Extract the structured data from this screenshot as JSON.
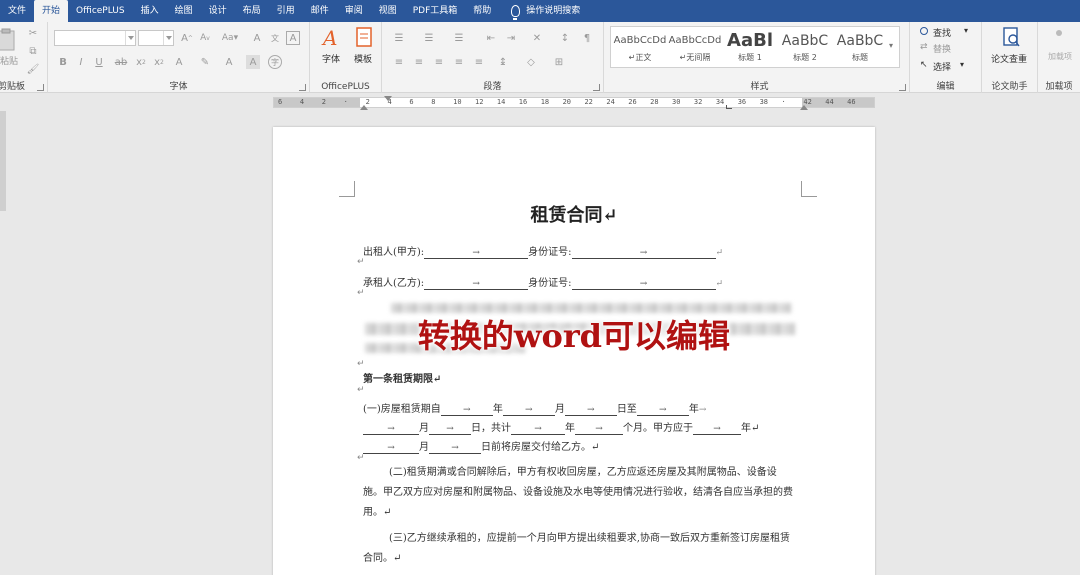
{
  "tabs": [
    "文件",
    "开始",
    "OfficePLUS",
    "插入",
    "绘图",
    "设计",
    "布局",
    "引用",
    "邮件",
    "审阅",
    "视图",
    "PDF工具箱",
    "帮助"
  ],
  "tell_me": "操作说明搜索",
  "ribbon": {
    "clipboard": {
      "paste": "粘贴",
      "label": "剪贴板"
    },
    "font": {
      "label": "字体"
    },
    "officeplus": {
      "font_btn": "字体",
      "template_btn": "模板",
      "label": "OfficePLUS"
    },
    "paragraph": {
      "label": "段落"
    },
    "styles": {
      "label": "样式",
      "items": [
        {
          "sample": "AaBbCcDd",
          "name": "↵正文"
        },
        {
          "sample": "AaBbCcDd",
          "name": "↵无间隔"
        },
        {
          "sample": "AaBl",
          "name": "标题 1"
        },
        {
          "sample": "AaBbC",
          "name": "标题 2"
        },
        {
          "sample": "AaBbC",
          "name": "标题"
        }
      ]
    },
    "editing": {
      "find": "查找",
      "replace": "替换",
      "select": "选择",
      "label": "编辑"
    },
    "thesis": {
      "check": "论文查重",
      "label": "论文助手"
    },
    "addins": {
      "item": "加载项",
      "label": "加载项"
    }
  },
  "ruler_ticks": [
    "6",
    "4",
    "2",
    "",
    "2",
    "4",
    "6",
    "8",
    "10",
    "12",
    "14",
    "16",
    "18",
    "20",
    "22",
    "24",
    "26",
    "28",
    "30",
    "32",
    "34",
    "36",
    "38",
    "",
    "42",
    "44",
    "46"
  ],
  "document": {
    "title": "租赁合同↵",
    "lessor_label": "出租人(甲方):",
    "lessee_label": "承租人(乙方):",
    "id_label": "身份证号:",
    "arrow": "→",
    "return_mark": "↵",
    "overlay": "转换的word可以编辑",
    "article1_heading": "第一条租赁期限↵",
    "p1_parts": [
      "(一)房屋租赁期自",
      "年",
      "月",
      "日至",
      "年"
    ],
    "p1_line2_parts": [
      "月",
      "日，共计",
      "年",
      "个月。甲方应于",
      "年↵"
    ],
    "p1_line3_parts": [
      "月",
      "日前将房屋交付给乙方。↵"
    ],
    "p2": "(二)租赁期满或合同解除后，甲方有权收回房屋，乙方应返还房屋及其附属物品、设备设施。甲乙双方应对房屋和附属物品、设备设施及水电等使用情况进行验收，结清各自应当承担的费用。↵",
    "p3": "(三)乙方继续承租的，应提前一个月向甲方提出续租要求,协商一致后双方重新签订房屋租赁合同。↵"
  },
  "colors": {
    "titlebar": "#2b579a",
    "overlay_text": "#b01212"
  }
}
